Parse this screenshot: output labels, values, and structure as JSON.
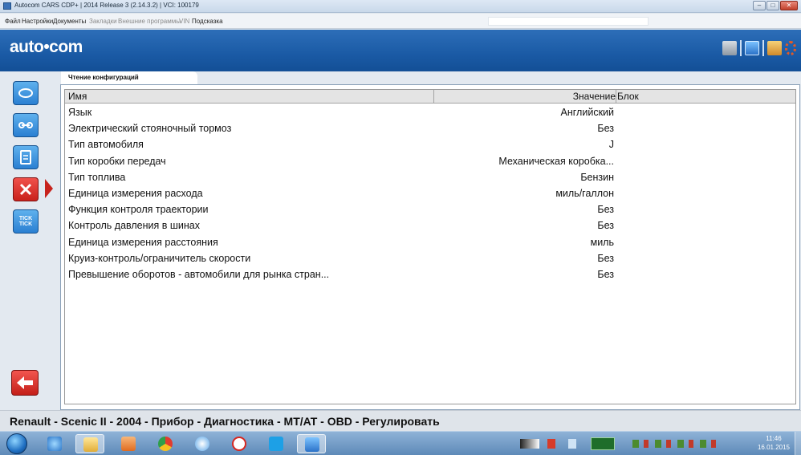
{
  "window": {
    "title": "Autocom CARS CDP+ | 2014 Release 3 (2.14.3.2) | VCI: 100179"
  },
  "menu": {
    "items": [
      "Файл",
      "Настройки",
      "Документы",
      "Закладки",
      "Внешние программы",
      "VIN",
      "Подсказка"
    ]
  },
  "header": {
    "logo": "auto•com"
  },
  "tab": {
    "label": "Чтение конфигураций"
  },
  "table": {
    "columns": [
      "Имя",
      "Значение",
      "Блок"
    ],
    "rows": [
      {
        "name": "Язык",
        "value": "Английский"
      },
      {
        "name": "Электрический стояночный тормоз",
        "value": "Без"
      },
      {
        "name": "Тип автомобиля",
        "value": "J"
      },
      {
        "name": "Тип коробки передач",
        "value": "Механическая коробка..."
      },
      {
        "name": "Тип топлива",
        "value": "Бензин"
      },
      {
        "name": "Единица измерения расхода",
        "value": "миль/галлон"
      },
      {
        "name": "Функция контроля траектории",
        "value": "Без"
      },
      {
        "name": "Контроль давления в шинах",
        "value": "Без"
      },
      {
        "name": "Единица измерения расстояния",
        "value": "миль"
      },
      {
        "name": "Круиз-контроль/ограничитель скорости",
        "value": "Без"
      },
      {
        "name": "Превышение оборотов - автомобили для рынка стран...",
        "value": "Без"
      }
    ]
  },
  "sidebar": {
    "tick_label": "TICK TICK"
  },
  "status": {
    "text": "Renault - Scenic II - 2004 - Прибор - Диагностика - MT/AT - OBD - Регулировать"
  },
  "taskbar": {
    "clock_time": "11:46",
    "clock_date": "16.01.2015"
  },
  "colors": {
    "header_blue": "#1a5aa5",
    "sidebar_button_blue": "#2a7fd2",
    "active_red": "#c9211b"
  }
}
